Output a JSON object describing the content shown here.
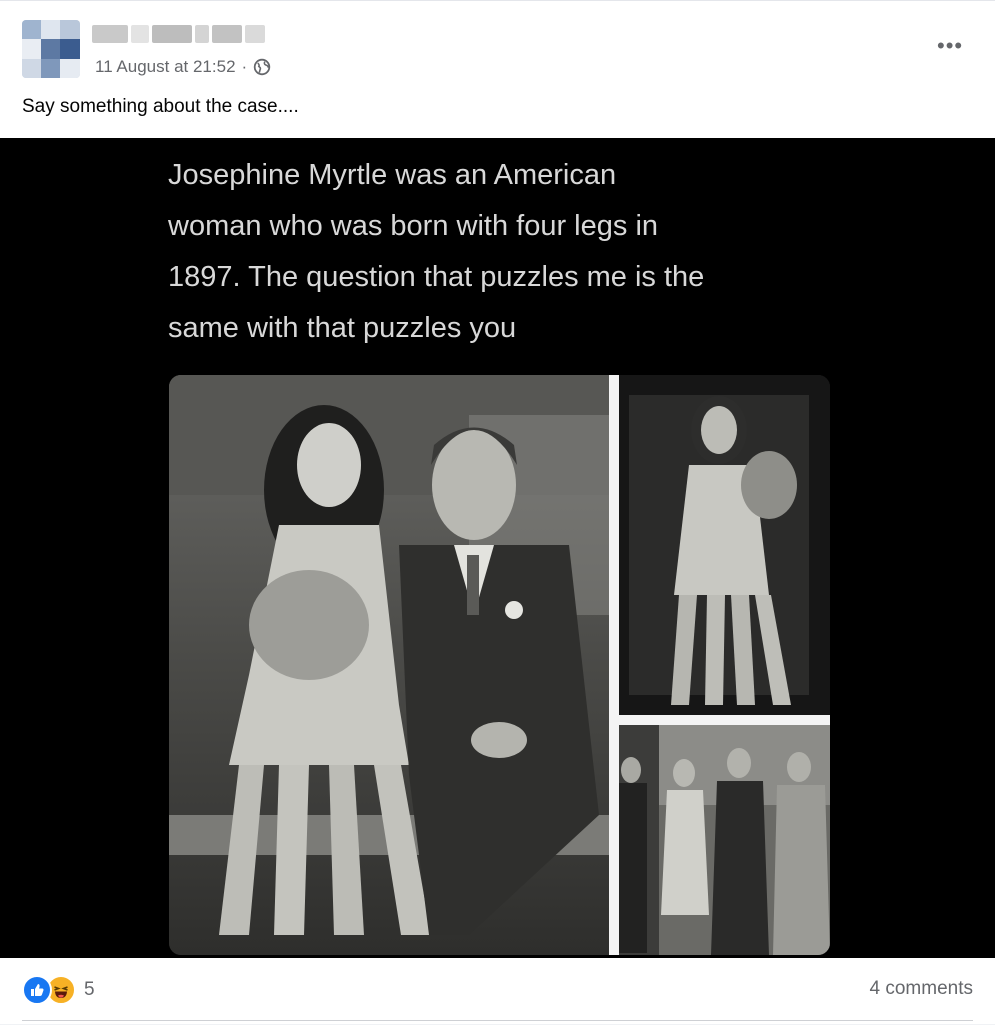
{
  "post": {
    "timestamp": "11 August at 21:52",
    "separator": "·",
    "audience_icon": "globe-icon",
    "more_icon": "more-options-icon",
    "caption": "Say something about the case....",
    "image_text": "Josephine Myrtle was an American\nwoman who was born with four legs in\n1897. The question that puzzles me is the\nsame with that puzzles you"
  },
  "footer": {
    "reaction_icons": [
      "like-icon",
      "haha-icon"
    ],
    "reaction_count": "5",
    "comments_label": "4 comments"
  },
  "colors": {
    "like_blue": "#1877f2",
    "haha_yellow": "#f7b125",
    "meta_gray": "#65676b",
    "media_bg": "#000000"
  }
}
